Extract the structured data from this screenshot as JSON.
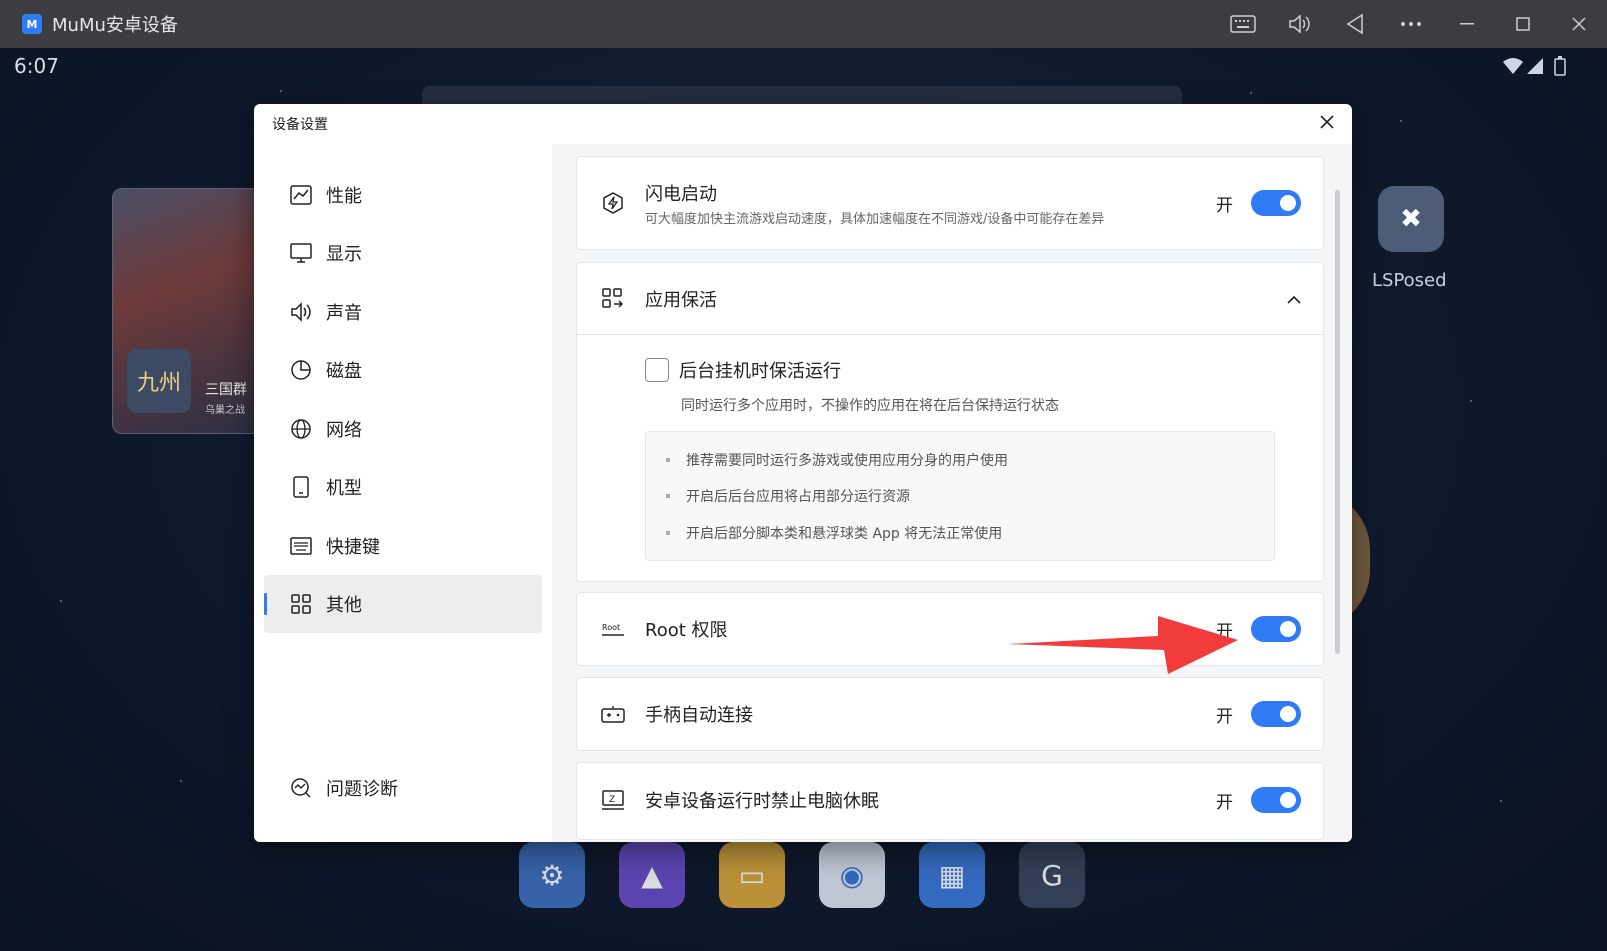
{
  "window": {
    "title": "MuMu安卓设备",
    "controls": [
      "keyboard-icon",
      "volume-icon",
      "back-icon",
      "more-icon",
      "minimize-icon",
      "maximize-icon",
      "close-icon"
    ]
  },
  "android": {
    "time": "6:07",
    "status_icons": [
      "wifi-icon",
      "signal-icon",
      "battery-icon"
    ],
    "game_card": {
      "title": "三国群",
      "subtitle": "乌巢之战",
      "logo": "九州"
    },
    "lsposed_label": "LSPosed",
    "dock": [
      "settings-icon",
      "gallery-icon",
      "files-icon",
      "browser-icon",
      "apps-icon",
      "google-icon"
    ]
  },
  "dialog": {
    "title": "设备设置",
    "close_icon": "close-icon",
    "sidebar": {
      "items": [
        {
          "label": "性能",
          "icon": "performance-icon"
        },
        {
          "label": "显示",
          "icon": "monitor-icon"
        },
        {
          "label": "声音",
          "icon": "speaker-icon"
        },
        {
          "label": "磁盘",
          "icon": "disk-icon"
        },
        {
          "label": "网络",
          "icon": "globe-icon"
        },
        {
          "label": "机型",
          "icon": "phone-icon"
        },
        {
          "label": "快捷键",
          "icon": "keyboard-icon"
        },
        {
          "label": "其他",
          "icon": "grid-icon",
          "active": true
        }
      ],
      "footer": {
        "label": "问题诊断",
        "icon": "diagnose-icon"
      }
    },
    "settings": {
      "flash_boot": {
        "title": "闪电启动",
        "desc": "可大幅度加快主流游戏启动速度，具体加速幅度在不同游戏/设备中可能存在差异",
        "state": "开",
        "enabled": true
      },
      "keep_alive": {
        "title": "应用保活",
        "option_label": "后台挂机时保活运行",
        "option_desc": "同时运行多个应用时，不操作的应用在将在后台保持运行状态",
        "checked": false,
        "tips": [
          "推荐需要同时运行多游戏或使用应用分身的用户使用",
          "开启后后台应用将占用部分运行资源",
          "开启后部分脚本类和悬浮球类 App 将无法正常使用"
        ]
      },
      "root": {
        "title": "Root 权限",
        "icon_text": "Root",
        "state": "开",
        "enabled": true
      },
      "gamepad": {
        "title": "手柄自动连接",
        "state": "开",
        "enabled": true
      },
      "no_sleep": {
        "title": "安卓设备运行时禁止电脑休眠",
        "icon_text": "Z",
        "state": "开",
        "enabled": true
      }
    },
    "accent_color": "#2f7bf5",
    "annotation_arrow_color": "#f23b3b"
  }
}
